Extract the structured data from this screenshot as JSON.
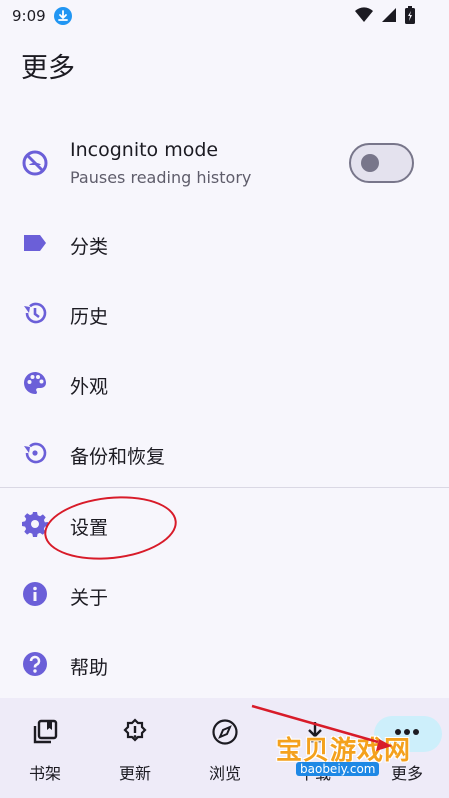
{
  "status_bar": {
    "time": "9:09",
    "icons": [
      "download-icon",
      "wifi-icon",
      "signal-icon",
      "battery-icon"
    ]
  },
  "page": {
    "title": "更多"
  },
  "incognito": {
    "title": "Incognito mode",
    "subtitle": "Pauses reading history",
    "enabled": false,
    "icon": "incognito-icon"
  },
  "menu": {
    "items": [
      {
        "label": "分类",
        "icon": "label-icon"
      },
      {
        "label": "历史",
        "icon": "history-icon"
      },
      {
        "label": "外观",
        "icon": "palette-icon"
      },
      {
        "label": "备份和恢复",
        "icon": "restore-icon"
      },
      {
        "label": "设置",
        "icon": "gear-icon"
      },
      {
        "label": "关于",
        "icon": "info-icon"
      },
      {
        "label": "帮助",
        "icon": "help-icon"
      }
    ]
  },
  "bottom_nav": {
    "items": [
      {
        "label": "书架",
        "icon": "library-icon",
        "active": false
      },
      {
        "label": "更新",
        "icon": "updates-icon",
        "active": false
      },
      {
        "label": "浏览",
        "icon": "compass-icon",
        "active": false
      },
      {
        "label": "下载",
        "icon": "download-queue-icon",
        "active": false
      },
      {
        "label": "更多",
        "icon": "more-icon",
        "active": true
      }
    ]
  },
  "watermark": {
    "text": "宝贝游戏网",
    "url": "baobeiy.com"
  },
  "colors": {
    "accent": "#6b5fd8",
    "background": "#f7f6fc",
    "nav_background": "#eeebf8",
    "annotation": "#d81b29"
  }
}
